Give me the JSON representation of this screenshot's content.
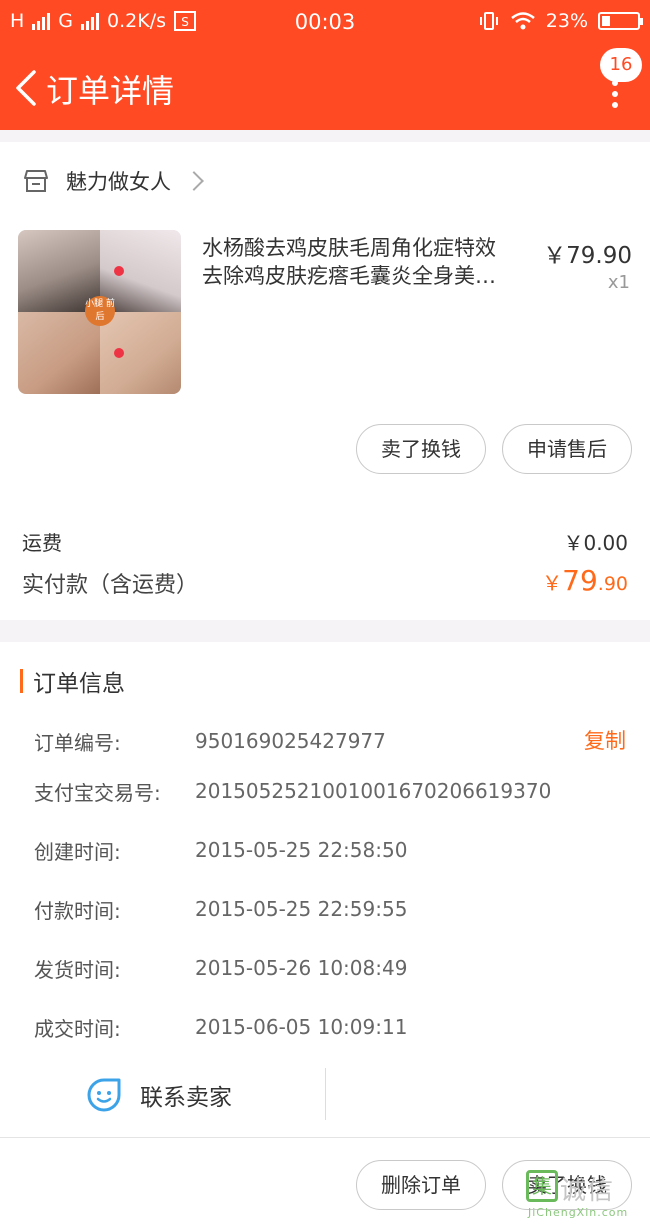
{
  "status_bar": {
    "signal1": "H",
    "signal2": "G",
    "speed": "0.2K/s",
    "time": "00:03",
    "battery": "23%",
    "battery_level": 0.23
  },
  "header": {
    "title": "订单详情",
    "badge": "16"
  },
  "shop": {
    "name": "魅力做女人"
  },
  "product": {
    "title_line1": "水杨酸去鸡皮肤毛周角化症特效",
    "title_line2": "去除鸡皮肤疙瘩毛囊炎全身美…",
    "price": "￥79.90",
    "qty": "x1",
    "image_badge": "小腿\n前后",
    "buttons": [
      "卖了换钱",
      "申请售后"
    ]
  },
  "summary": {
    "shipping_label": "运费",
    "shipping_value": "￥0.00",
    "paid_label": "实付款（含运费）",
    "paid_currency": "￥",
    "paid_int": "79",
    "paid_dec": ".90"
  },
  "order_info": {
    "title": "订单信息",
    "copy_label": "复制",
    "rows": [
      {
        "label": "订单编号:",
        "value": "950169025427977"
      },
      {
        "label": "支付宝交易号:",
        "value": "2015052521001001670206619370"
      },
      {
        "label": "创建时间:",
        "value": "2015-05-25 22:58:50"
      },
      {
        "label": "付款时间:",
        "value": "2015-05-25 22:59:55"
      },
      {
        "label": "发货时间:",
        "value": "2015-05-26 10:08:49"
      },
      {
        "label": "成交时间:",
        "value": "2015-06-05 10:09:11"
      }
    ]
  },
  "contact": {
    "label": "联系卖家",
    "icon": "chat-face-icon"
  },
  "footer": {
    "buttons": [
      "删除订单",
      "卖了换钱"
    ]
  },
  "watermark": {
    "logo_char": "集",
    "text": "诚信",
    "url": "JiChengXin.com"
  },
  "colors": {
    "brand": "#ff4a23",
    "accent": "#ff6a1a",
    "contact_icon": "#3da3e8"
  }
}
